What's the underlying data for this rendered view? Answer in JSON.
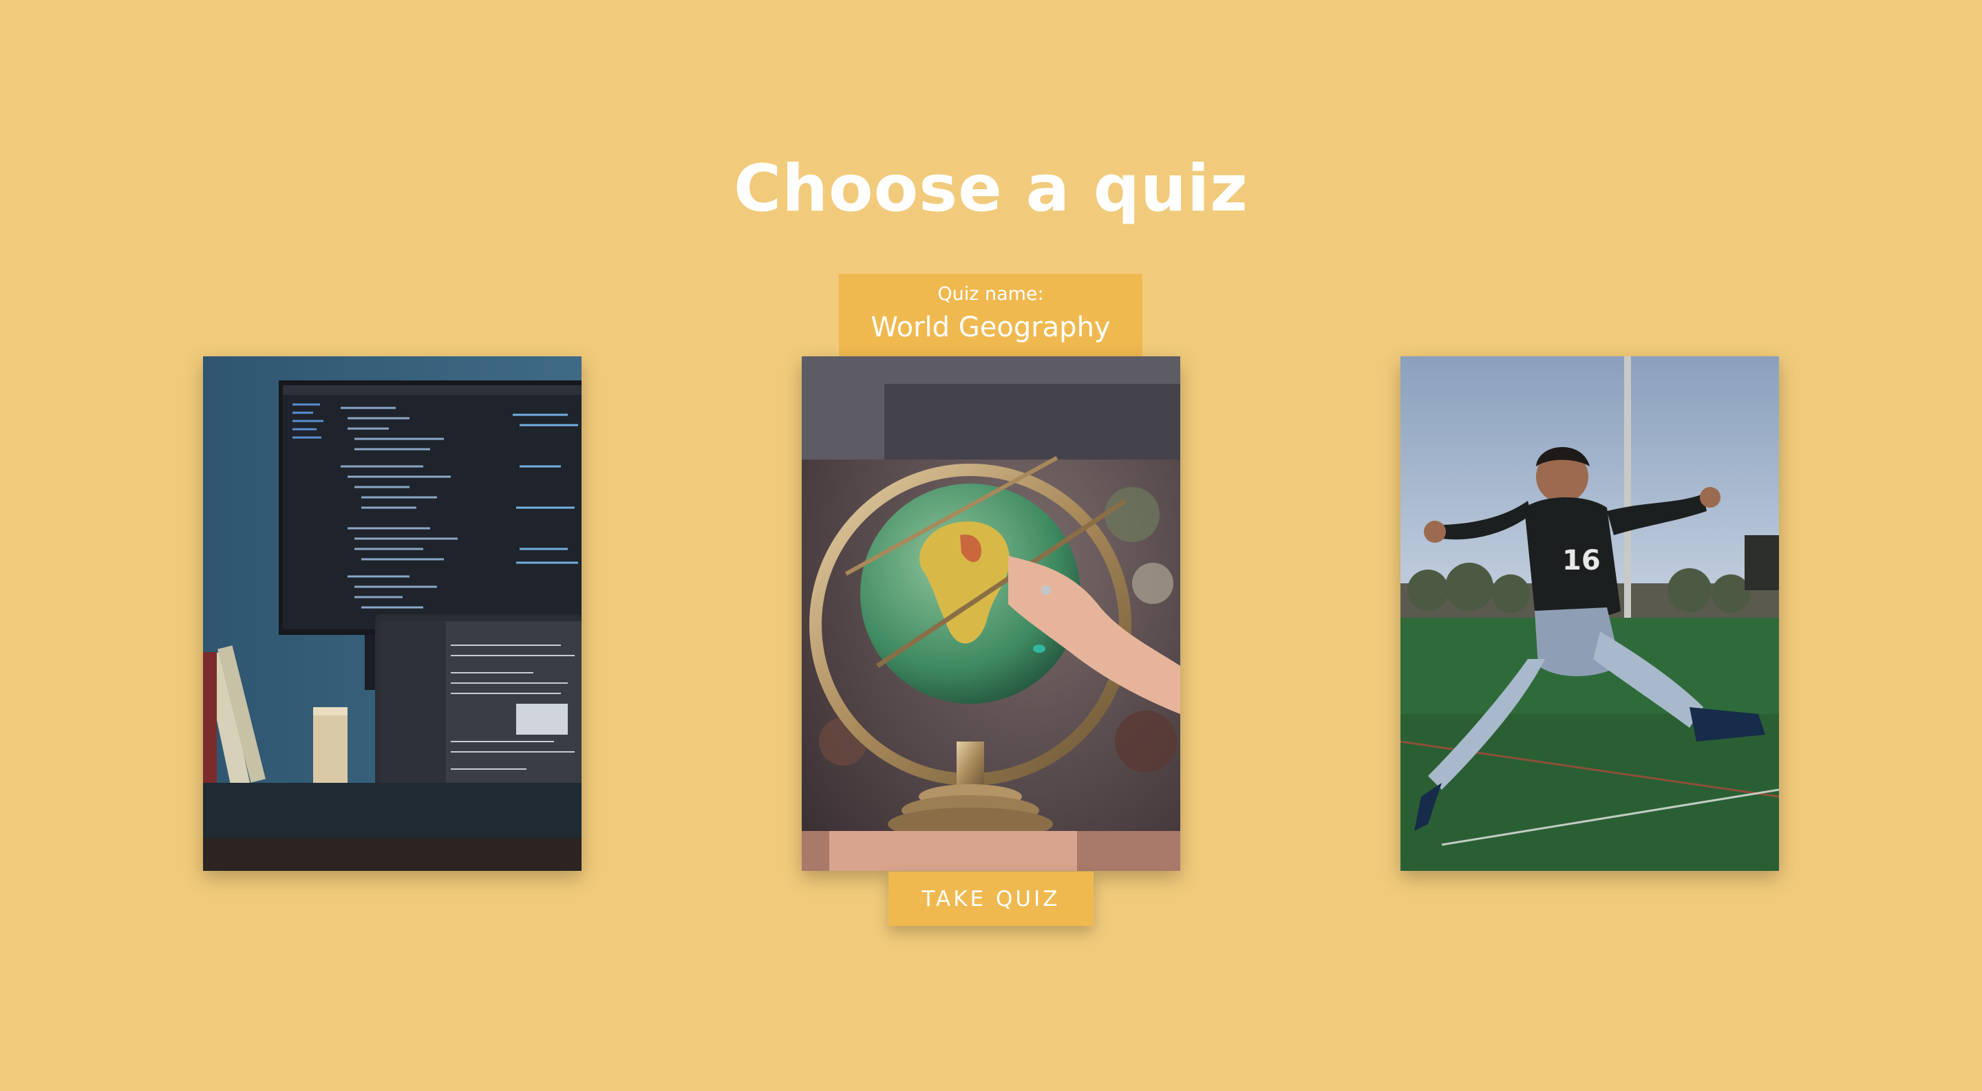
{
  "page": {
    "title": "Choose a quiz"
  },
  "featured_quiz": {
    "label": "Quiz name:",
    "name": "World Geography",
    "button_label": "TAKE QUIZ"
  },
  "cards": [
    {
      "image": "programming-desk-photo"
    },
    {
      "image": "globe-photo"
    },
    {
      "image": "soccer-player-photo"
    }
  ],
  "colors": {
    "background": "#f1cb7b",
    "accent": "#f0b950",
    "text": "#ffffff"
  }
}
